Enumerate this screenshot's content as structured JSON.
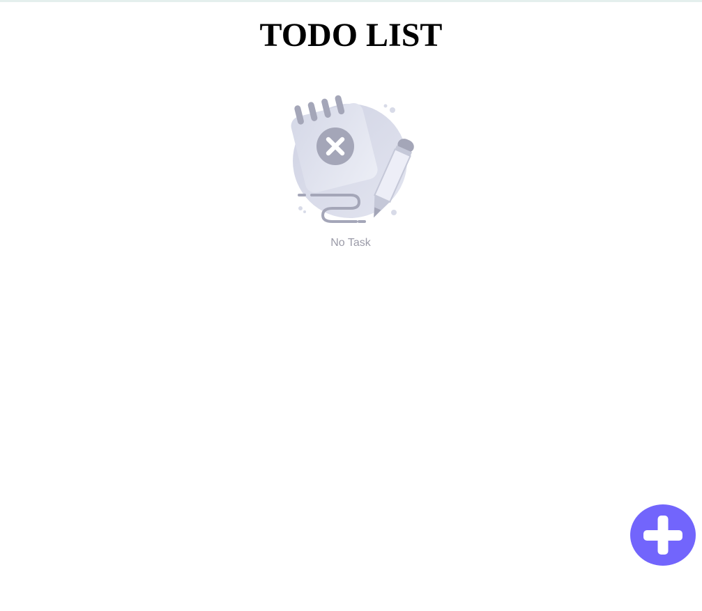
{
  "header": {
    "title": "TODO LIST"
  },
  "empty_state": {
    "icon": "empty-notepad-icon",
    "message": "No Task"
  },
  "fab": {
    "icon": "plus-icon",
    "color": "#7265fc"
  },
  "colors": {
    "background": "#ffffff",
    "top_border": "#e4efed",
    "illustration_gray": "#a4a6b8",
    "illustration_light": "#d8dbe8",
    "muted_text": "#9b9ba8"
  }
}
